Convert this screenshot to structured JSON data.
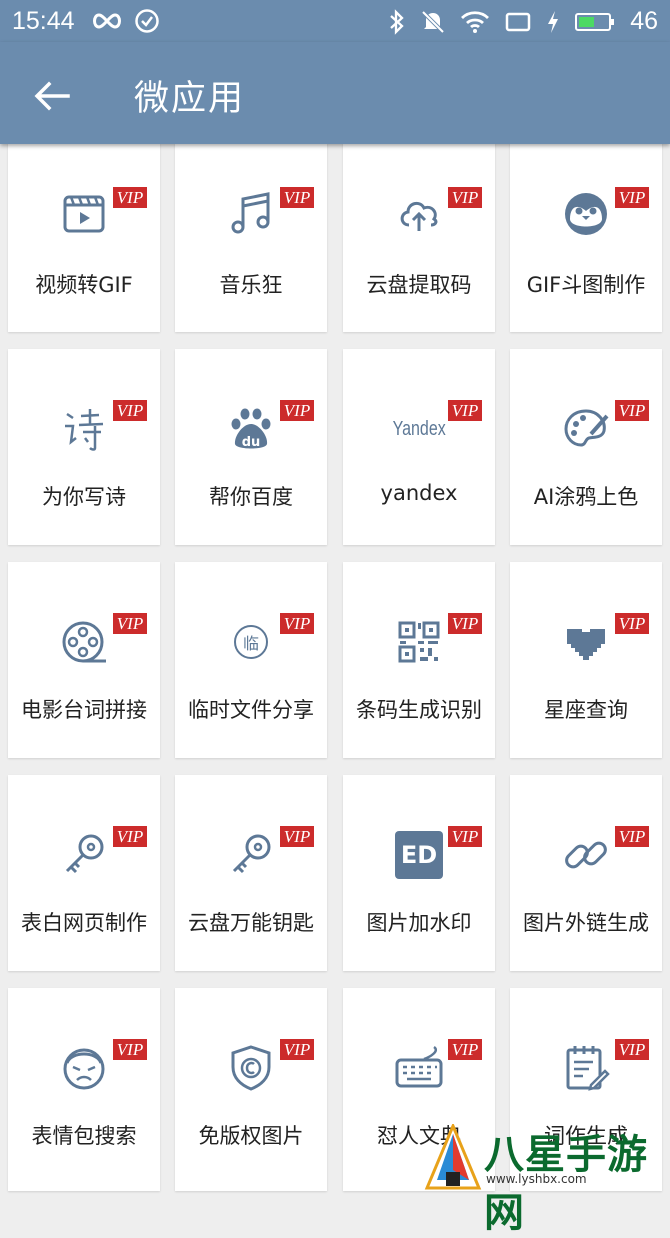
{
  "status_bar": {
    "time": "15:44",
    "battery_level": "46"
  },
  "app_bar": {
    "title": "微应用"
  },
  "tiles": [
    {
      "label": "视频转GIF",
      "badge": "VIP",
      "icon": "video-clip-icon"
    },
    {
      "label": "音乐狂",
      "badge": "VIP",
      "icon": "music-note-icon"
    },
    {
      "label": "云盘提取码",
      "badge": "VIP",
      "icon": "cloud-upload-icon"
    },
    {
      "label": "GIF斗图制作",
      "badge": "VIP",
      "icon": "penguin-face-icon"
    },
    {
      "label": "为你写诗",
      "badge": "VIP",
      "icon": "poem-calligraphy-icon"
    },
    {
      "label": "帮你百度",
      "badge": "VIP",
      "icon": "baidu-paw-icon"
    },
    {
      "label": "yandex",
      "badge": "VIP",
      "icon": "yandex-logo-icon",
      "icon_text": "Yandex"
    },
    {
      "label": "AI涂鸦上色",
      "badge": "VIP",
      "icon": "palette-icon"
    },
    {
      "label": "电影台词拼接",
      "badge": "VIP",
      "icon": "film-reel-icon"
    },
    {
      "label": "临时文件分享",
      "badge": "VIP",
      "icon": "temp-stamp-icon",
      "icon_text": "临"
    },
    {
      "label": "条码生成识别",
      "badge": "VIP",
      "icon": "qr-code-icon"
    },
    {
      "label": "星座查询",
      "badge": "VIP",
      "icon": "pixel-heart-icon"
    },
    {
      "label": "表白网页制作",
      "badge": "VIP",
      "icon": "key-icon"
    },
    {
      "label": "云盘万能钥匙",
      "badge": "VIP",
      "icon": "key-icon"
    },
    {
      "label": "图片加水印",
      "badge": "VIP",
      "icon": "stamp-print-icon",
      "icon_text": "ED"
    },
    {
      "label": "图片外链生成",
      "badge": "VIP",
      "icon": "chain-link-icon"
    },
    {
      "label": "表情包搜索",
      "badge": "VIP",
      "icon": "sad-face-icon"
    },
    {
      "label": "免版权图片",
      "badge": "VIP",
      "icon": "copyright-shield-icon"
    },
    {
      "label": "怼人文典",
      "badge": "VIP",
      "icon": "keyboard-icon"
    },
    {
      "label": "词作生成",
      "badge": "VIP",
      "icon": "notepad-edit-icon"
    }
  ],
  "watermark": {
    "text": "八星手游网",
    "url": "www.lyshbx.com"
  },
  "colors": {
    "primary": "#6b8cae",
    "badge": "#cc2b2b",
    "icon": "#5d7896"
  }
}
